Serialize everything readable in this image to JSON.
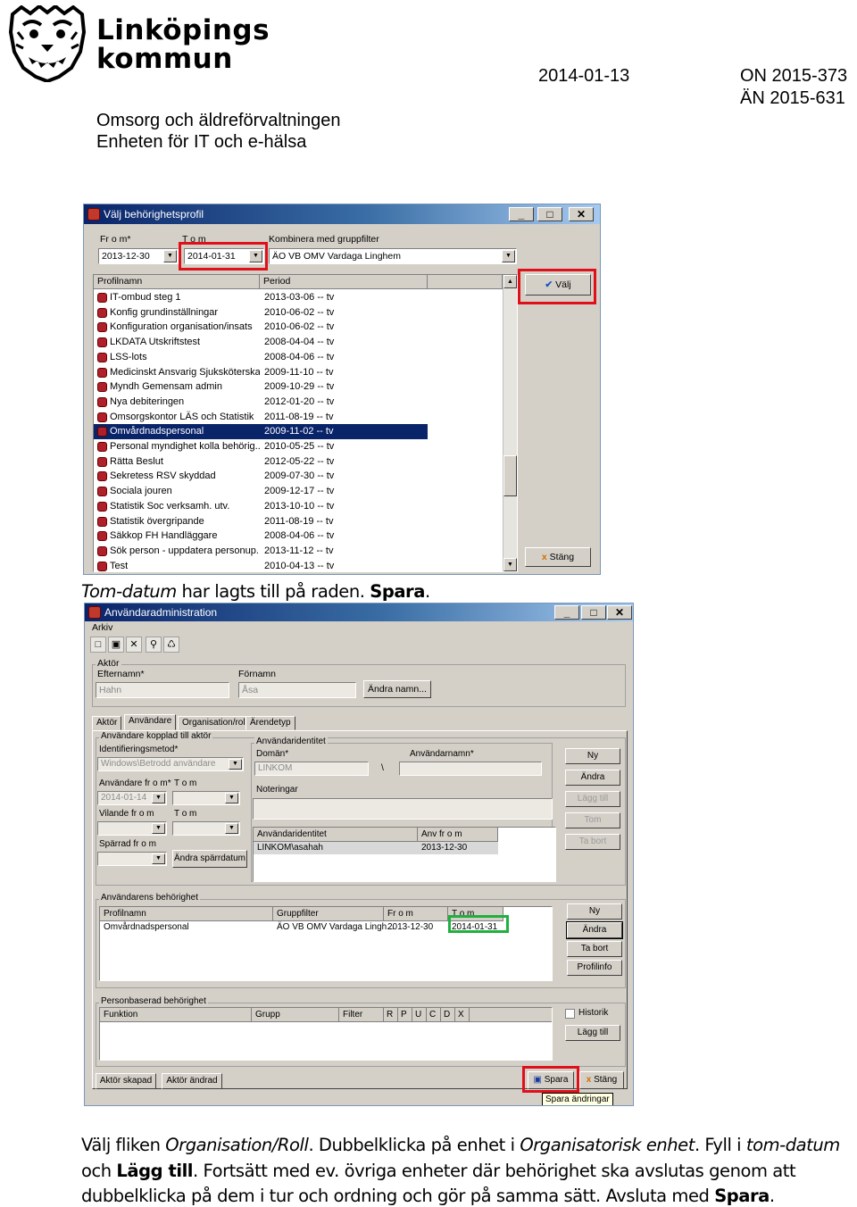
{
  "header": {
    "logo_line1": "Linköpings",
    "logo_line2": "kommun",
    "date": "2014-01-13",
    "ref1": "ON 2015-373",
    "ref2": "ÄN 2015-631",
    "org1": "Omsorg och äldreförvaltningen",
    "org2": "Enheten för IT och e-hälsa"
  },
  "dialog1": {
    "title": "Välj behörighetsprofil",
    "from_label": "Fr o m*",
    "from_value": "2013-12-30",
    "to_label": "T o m",
    "to_value": "2014-01-31",
    "combine_label": "Kombinera med gruppfilter",
    "combine_value": "ÄO VB OMV Vardaga Linghem",
    "col_profile": "Profilnamn",
    "col_period": "Period",
    "btn_choose": "Välj",
    "btn_close": "Stäng",
    "profiles": [
      {
        "name": "IT-ombud steg 1",
        "period": "2013-03-06 -- tv"
      },
      {
        "name": "Konfig grundinställningar",
        "period": "2010-06-02 -- tv"
      },
      {
        "name": "Konfiguration organisation/insats",
        "period": "2010-06-02 -- tv"
      },
      {
        "name": "LKDATA Utskriftstest",
        "period": "2008-04-04 -- tv"
      },
      {
        "name": "LSS-lots",
        "period": "2008-04-06 -- tv"
      },
      {
        "name": "Medicinskt Ansvarig Sjuksköterska",
        "period": "2009-11-10 -- tv"
      },
      {
        "name": "Myndh Gemensam admin",
        "period": "2009-10-29 -- tv"
      },
      {
        "name": "Nya debiteringen",
        "period": "2012-01-20 -- tv"
      },
      {
        "name": "Omsorgskontor LÄS och Statistik",
        "period": "2011-08-19 -- tv"
      },
      {
        "name": "Omvårdnadspersonal",
        "period": "2009-11-02 -- tv"
      },
      {
        "name": "Personal myndighet kolla behörig...",
        "period": "2010-05-25 -- tv"
      },
      {
        "name": "Rätta Beslut",
        "period": "2012-05-22 -- tv"
      },
      {
        "name": "Sekretess RSV skyddad",
        "period": "2009-07-30 -- tv"
      },
      {
        "name": "Sociala jouren",
        "period": "2009-12-17 -- tv"
      },
      {
        "name": "Statistik Soc verksamh. utv.",
        "period": "2013-10-10 -- tv"
      },
      {
        "name": "Statistik övergripande",
        "period": "2011-08-19 -- tv"
      },
      {
        "name": "Säkkop FH Handläggare",
        "period": "2008-04-06 -- tv"
      },
      {
        "name": "Sök person - uppdatera personup...",
        "period": "2013-11-12 -- tv"
      },
      {
        "name": "Test",
        "period": "2010-04-13 -- tv"
      }
    ],
    "selected_index": 9
  },
  "caption1": {
    "italic": "Tom-datum",
    "text": " har lagts till på raden. ",
    "bold": "Spara",
    "end": "."
  },
  "dialog2": {
    "title": "Användaradministration",
    "menu_file": "Arkiv",
    "actor_group": "Aktör",
    "lastname_label": "Efternamn*",
    "lastname_value": "Hahn",
    "firstname_label": "Förnamn",
    "firstname_value": "Åsa",
    "change_name_btn": "Ändra namn...",
    "tabs": [
      "Aktör",
      "Användare",
      "Organisation/roll",
      "Ärendetyp"
    ],
    "user_group": "Användare kopplad till aktör",
    "idmethod_label": "Identifieringsmetod*",
    "idmethod_value": "Windows\\Betrodd användare",
    "user_from_label": "Användare fr o m*",
    "user_to_label": "T o m",
    "user_from_value": "2014-01-14",
    "rest_from_label": "Vilande fr o m",
    "rest_to_label": "T o m",
    "block_from_label": "Spärrad fr o m",
    "change_block_btn": "Ändra spärrdatum",
    "userid_group": "Användaridentitet",
    "domain_label": "Domän*",
    "domain_value": "LINKOM",
    "username_label": "Användarnamn*",
    "backslash": "\\",
    "notes_label": "Noteringar",
    "uid_col": "Användaridentitet",
    "uid_from_col": "Anv fr o m",
    "uid_value": "LINKOM\\asahah",
    "uid_from_value": "2013-12-30",
    "btn_new": "Ny",
    "btn_change": "Ändra",
    "btn_add": "Lägg till",
    "btn_empty": "Tom",
    "btn_remove": "Ta bort",
    "perm_group": "Användarens behörighet",
    "perm_cols": [
      "Profilnamn",
      "Gruppfilter",
      "Fr o m",
      "T o m"
    ],
    "perm_row": {
      "profile": "Omvårdnadspersonal",
      "filter": "ÄO VB OMV Vardaga Lingh...",
      "from": "2013-12-30",
      "to": "2014-01-31"
    },
    "perm_btn_new": "Ny",
    "perm_btn_change": "Ändra",
    "perm_btn_remove": "Ta bort",
    "perm_btn_info": "Profilinfo",
    "personal_group": "Personbaserad behörighet",
    "pers_cols": [
      "Funktion",
      "Grupp",
      "Filter",
      "R",
      "P",
      "U",
      "C",
      "D",
      "X"
    ],
    "history_label": "Historik",
    "pers_btn_add": "Lägg till",
    "status_created": "Aktör skapad",
    "status_changed": "Aktör ändrad",
    "btn_save": "Spara",
    "btn_close": "Stäng",
    "tooltip": "Spara ändringar"
  },
  "caption2": {
    "l1_a": "Välj fliken ",
    "l1_b": "Organisation/Roll",
    "l1_c": ". Dubbelklicka på enhet i ",
    "l1_d": "Organisatorisk enhet",
    "l1_e": ". Fyll i ",
    "l1_f": "tom-datum",
    "l2_a": "och ",
    "l2_b": "Lägg till",
    "l2_c": ". Fortsätt med ev. övriga enheter där behörighet ska avslutas genom att",
    "l3_a": "dubbelklicka på dem i tur och ordning och gör på samma sätt. Avsluta med ",
    "l3_b": "Spara",
    "l3_c": "."
  },
  "colors": {
    "highlight_red": "#e0101b",
    "highlight_green": "#1fb040",
    "selection": "#0a246a"
  }
}
